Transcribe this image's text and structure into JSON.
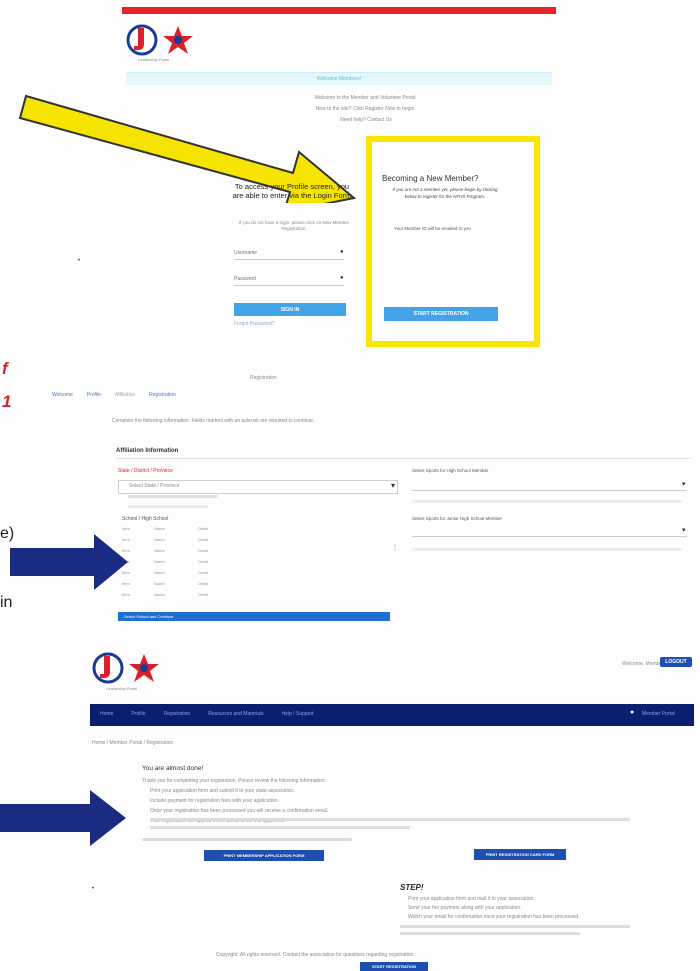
{
  "top_logo": {
    "sub": "Leadership Portal"
  },
  "login": {
    "banner": "Welcome Members!",
    "intro_line1": "Welcome to the Member and Volunteer Portal",
    "intro_line2": "New to the site? Click Register Now to begin",
    "intro_line3": "Need help? Contact Us",
    "heading": "To access your Profile screen, you are able to enter via the Login Form",
    "hint": "If you do not have a login, please click on New Member Registration.",
    "username_placeholder": "Username",
    "password_placeholder": "Password",
    "signin_label": "SIGN IN",
    "forgot_label": "Forgot Password?"
  },
  "new_member": {
    "title": "Becoming a New Member?",
    "text": "If you are not a member yet, please begin by clicking below to register for the NFHS Program.",
    "note": "Your Member ID will be emailed to you",
    "button_label": "START REGISTRATION"
  },
  "annotations": {
    "left_red_1": "f",
    "left_red_2": "1",
    "left_label_1": "e)",
    "left_label_2": "in"
  },
  "registration": {
    "page_title": "Registration",
    "steps": [
      "Welcome",
      "Profile",
      "Affiliation",
      "Registration"
    ],
    "instructions": "Complete the following information. Fields marked with an asterisk are required to continue.",
    "section_title": "Affiliation Information",
    "state_label": "State / District / Province",
    "state_value": "Select State / Province",
    "school_label": "School / High School",
    "school_rows": [
      [
        "Item",
        "Name",
        "Detail"
      ],
      [
        "Item",
        "Name",
        "Detail"
      ],
      [
        "Item",
        "Name",
        "Detail"
      ],
      [
        "Item",
        "Name",
        "Detail"
      ],
      [
        "Item",
        "Name",
        "Detail"
      ],
      [
        "Item",
        "Name",
        "Detail"
      ],
      [
        "Item",
        "Name",
        "Detail"
      ]
    ],
    "select_button": "Select School and Continue",
    "right_label_1": "Select Sports for High School Member",
    "right_label_2": "Select Sports for Junior High School Member"
  },
  "bottom_page": {
    "logo_sub": "Leadership Portal",
    "header_link": "Welcome, Member",
    "logout_label": "LOGOUT",
    "nav_items": [
      "Home",
      "Profile",
      "Registration",
      "Resources and Materials",
      "Help / Support"
    ],
    "nav_right": "Member Portal",
    "breadcrumb": "Home / Member Portal / Registration",
    "title": "You are almost done!",
    "lines": [
      "Thank you for completing your registration. Please review the following information.",
      "Print your application form and submit it to your state association.",
      "Include payment for registration fees with your application.",
      "Once your registration has been processed you will receive a confirmation email.",
      "Your registration will appear in the portal when it is approved."
    ],
    "print_app_label": "PRINT MEMBERSHIP APPLICATION FORM",
    "print_reg_label": "PRINT REGISTRATION CARD FORM",
    "steps_title": "STEP!",
    "step_lines": [
      "Print your application form and mail it to your association.",
      "Send your fee payment along with your application.",
      "Watch your email for confirmation once your registration has been processed."
    ],
    "footer_text": "Copyright. All rights reserved. Contact the association for questions regarding registration.",
    "footer_button": "START REGISTRATION"
  },
  "colors": {
    "red_bar": "#e8202a",
    "yellow": "#f9e500",
    "navy_arrow": "#1a2c82",
    "nav_bg": "#0a1f6e",
    "blue_button": "#1e6fd1",
    "light_blue_button": "#43a3e8"
  }
}
